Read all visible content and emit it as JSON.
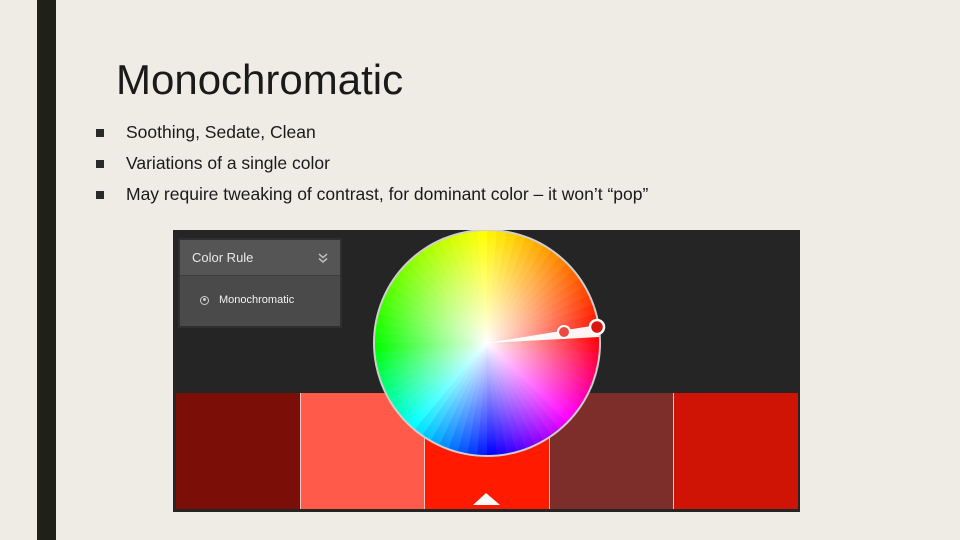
{
  "slide": {
    "title": "Monochromatic",
    "bullets": [
      "Soothing, Sedate, Clean",
      "Variations of a single color",
      "May require tweaking of contrast, for dominant color – it won’t “pop”"
    ]
  },
  "color_rule_panel": {
    "header_label": "Color Rule",
    "selected_option": "Monochromatic"
  },
  "swatches": [
    "#7c0e08",
    "#ff5a4a",
    "#ff1a00",
    "#7e2e2a",
    "#cf1405"
  ],
  "colors": {
    "slide_background": "#efece6",
    "left_bar": "#1f2116",
    "panel_background": "#252525",
    "base_marker": "#d9170f",
    "secondary_marker": "#ec4a40"
  },
  "icons": [
    "collapse-chevrons-icon",
    "radio-button-icon",
    "base-color-indicator-icon"
  ]
}
